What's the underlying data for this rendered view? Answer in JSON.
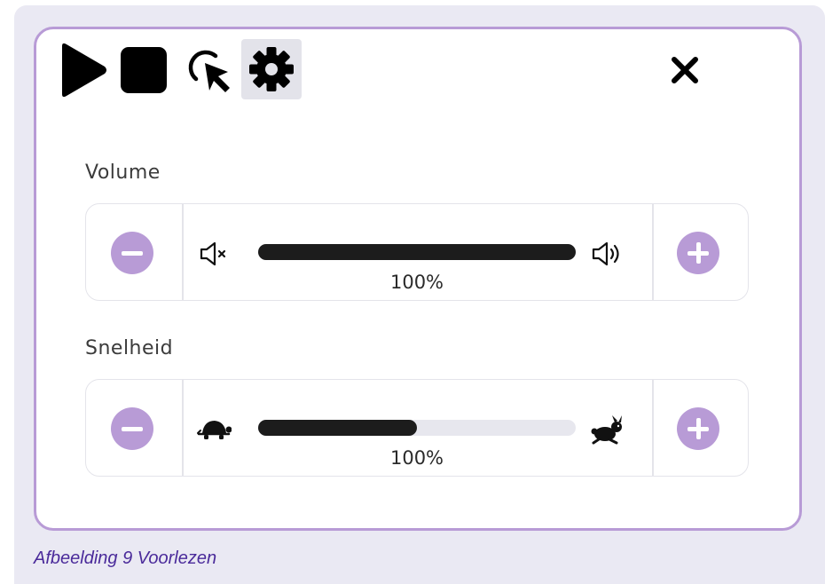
{
  "toolbar": {
    "icons": [
      "play-icon",
      "stop-icon",
      "click-select-icon",
      "gear-icon",
      "close-icon"
    ],
    "settings_active": true
  },
  "volume": {
    "label": "Volume",
    "value_text": "100%",
    "level_fraction": 1.0,
    "left_icon": "volume-mute-icon",
    "right_icon": "volume-up-icon"
  },
  "speed": {
    "label": "Snelheid",
    "value_text": "100%",
    "level_fraction": 0.5,
    "left_icon": "turtle-icon",
    "right_icon": "rabbit-icon"
  },
  "caption": "Afbeelding 9 Voorlezen",
  "colors": {
    "accent": "#b89bd6",
    "frame_bg": "#eae9f3",
    "caption": "#4a2a9a",
    "slider_fill": "#1c1c1c",
    "slider_track": "#e7e7ee"
  }
}
